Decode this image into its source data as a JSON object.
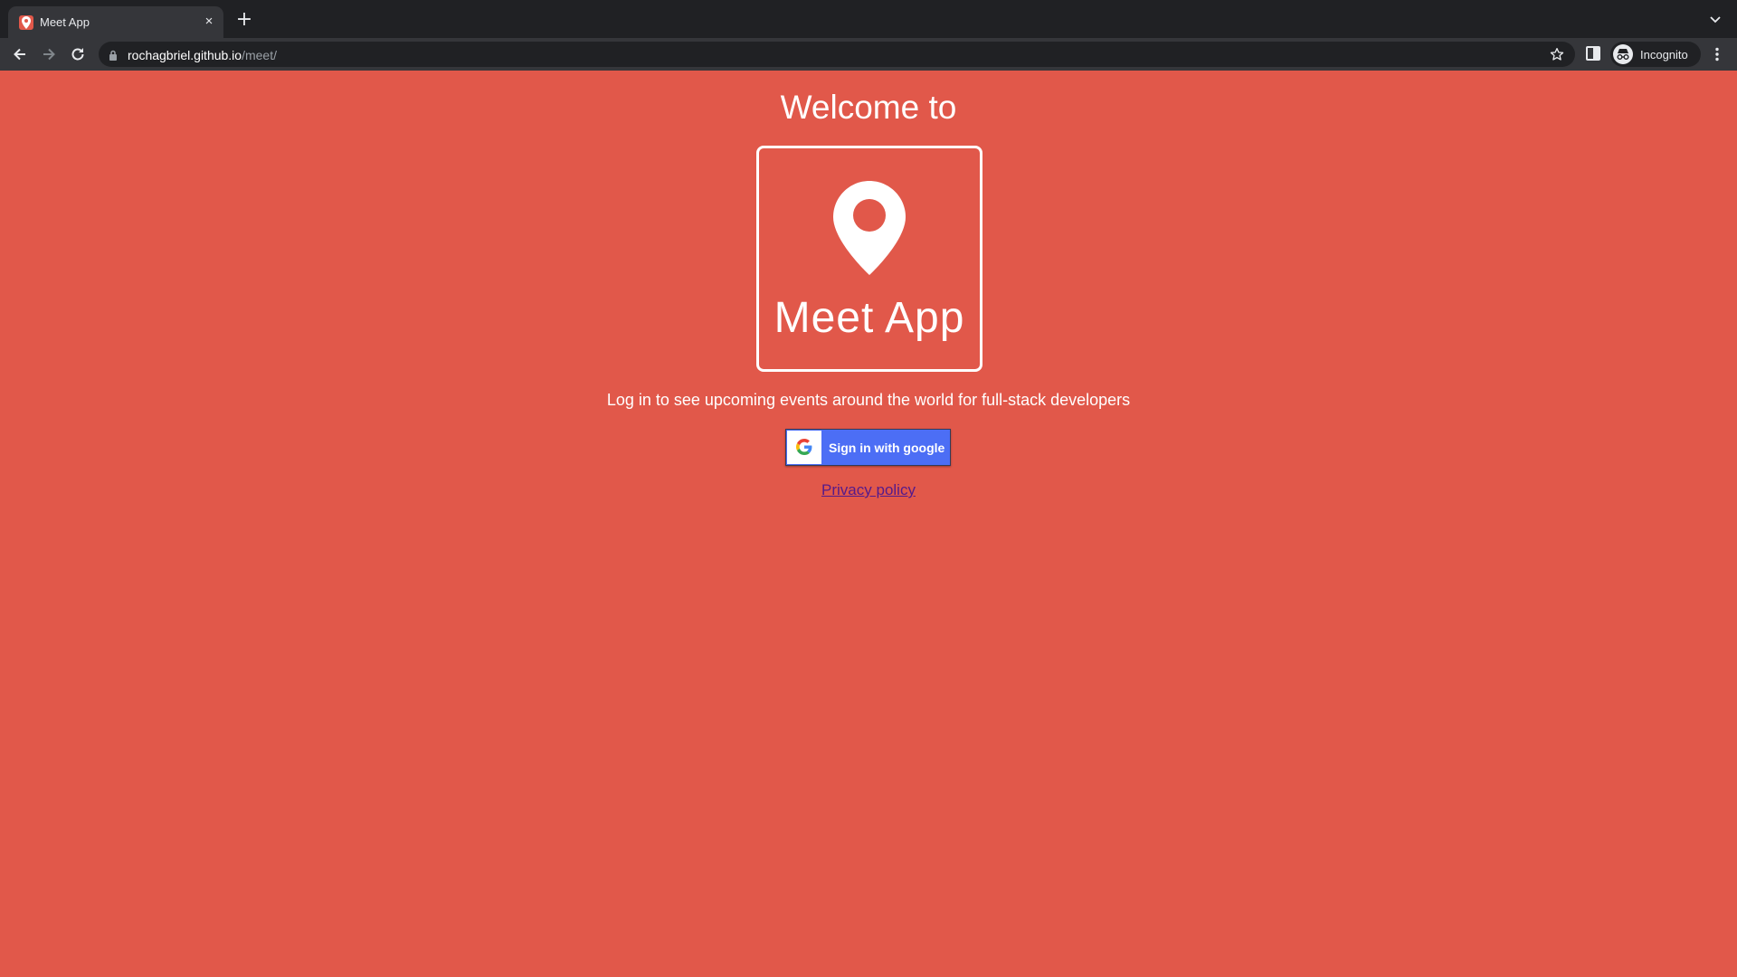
{
  "browser": {
    "tab": {
      "title": "Meet App",
      "close": "×"
    },
    "new_tab": "+",
    "address": {
      "host": "rochagbriel.github.io",
      "path": "/meet/"
    },
    "profile": {
      "label": "Incognito"
    }
  },
  "page": {
    "welcome": "Welcome to",
    "logo_text": "Meet App",
    "intro": "Log in to see upcoming events around the world for full-stack developers",
    "signin_label": "Sign in with google",
    "privacy_link": "Privacy policy"
  },
  "colors": {
    "background": "#e1584a",
    "signin_button": "#4c6ef5",
    "link": "#551a8b"
  },
  "icons": [
    "map-pin-icon",
    "google-g-icon",
    "back-icon",
    "forward-icon",
    "reload-icon",
    "lock-icon",
    "star-icon",
    "side-panel-icon",
    "incognito-icon",
    "more-menu-icon"
  ]
}
